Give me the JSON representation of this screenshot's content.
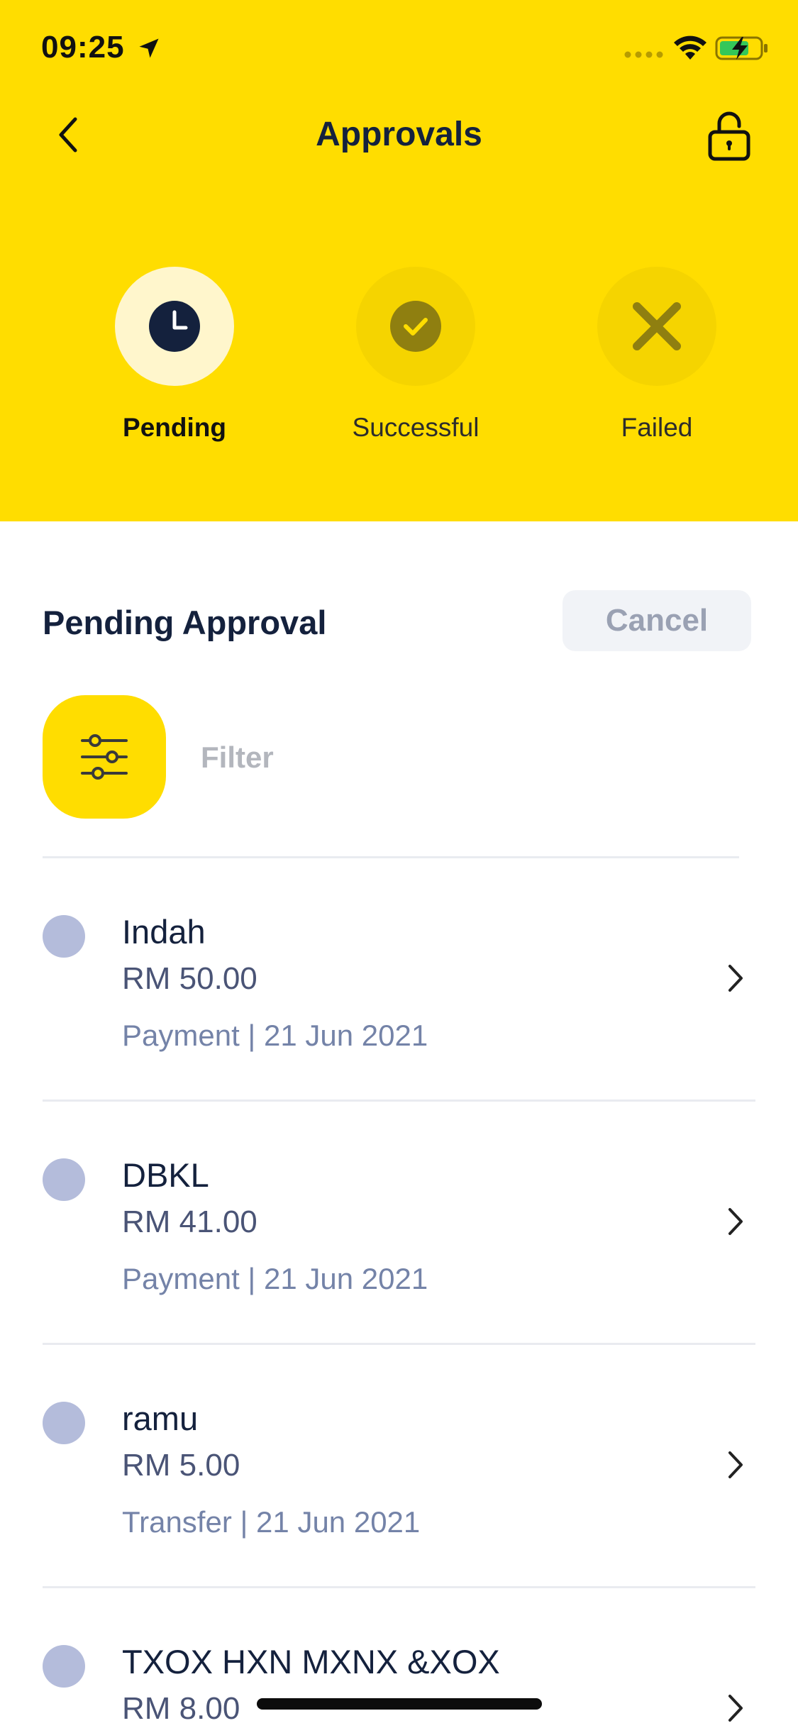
{
  "status_bar": {
    "time": "09:25"
  },
  "header": {
    "title": "Approvals"
  },
  "tabs": [
    {
      "label": "Pending",
      "icon": "clock-icon",
      "active": true
    },
    {
      "label": "Successful",
      "icon": "check-circle-icon",
      "active": false
    },
    {
      "label": "Failed",
      "icon": "x-icon",
      "active": false
    }
  ],
  "section": {
    "title": "Pending Approval",
    "cancel_label": "Cancel"
  },
  "filter": {
    "label": "Filter"
  },
  "approvals": [
    {
      "name": "Indah",
      "amount": "RM 50.00",
      "meta": "Payment | 21 Jun 2021"
    },
    {
      "name": "DBKL",
      "amount": "RM 41.00",
      "meta": "Payment | 21 Jun 2021"
    },
    {
      "name": "ramu",
      "amount": "RM 5.00",
      "meta": "Transfer | 21 Jun 2021"
    },
    {
      "name": "TXOX HXN MXNX &XOX",
      "amount": "RM 8.00",
      "meta": ""
    }
  ],
  "colors": {
    "brand_yellow": "#ffdd00",
    "navy_text": "#14213d",
    "dot": "#b4bcdb"
  }
}
